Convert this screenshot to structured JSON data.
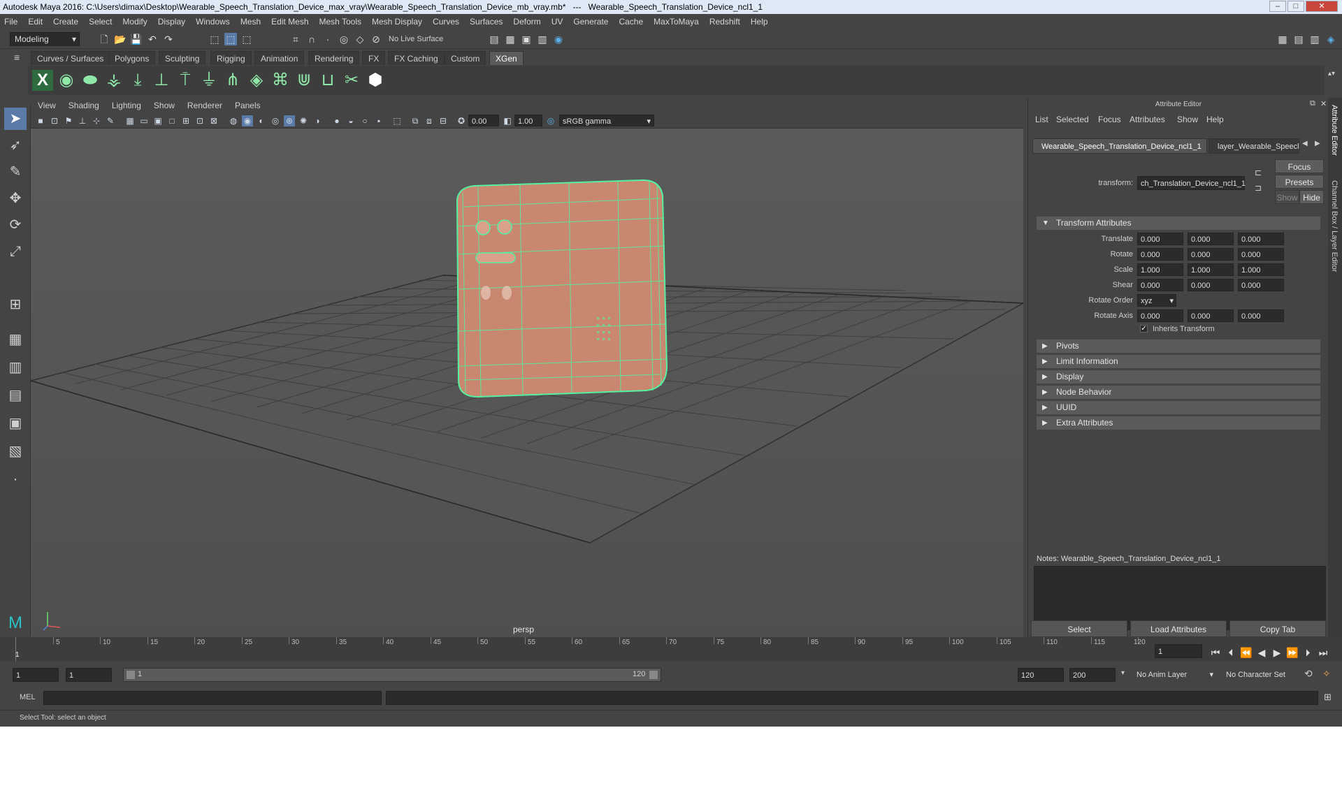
{
  "window": {
    "title": "Autodesk Maya 2016: C:\\Users\\dimax\\Desktop\\Wearable_Speech_Translation_Device_max_vray\\Wearable_Speech_Translation_Device_mb_vray.mb*",
    "separator": "---",
    "object": "Wearable_Speech_Translation_Device_ncl1_1",
    "min": "–",
    "max": "□",
    "close": "✕"
  },
  "menubar": [
    "File",
    "Edit",
    "Create",
    "Select",
    "Modify",
    "Display",
    "Windows",
    "Mesh",
    "Edit Mesh",
    "Mesh Tools",
    "Mesh Display",
    "Curves",
    "Surfaces",
    "Deform",
    "UV",
    "Generate",
    "Cache",
    "MaxToMaya",
    "Redshift",
    "Help"
  ],
  "status": {
    "mode": "Modeling",
    "live_surface": "No Live Surface"
  },
  "shelf_tabs": [
    "Curves / Surfaces",
    "Polygons",
    "Sculpting",
    "Rigging",
    "Animation",
    "Rendering",
    "FX",
    "FX Caching",
    "Custom",
    "XGen"
  ],
  "shelf_active": "XGen",
  "viewport": {
    "menus": [
      "View",
      "Shading",
      "Lighting",
      "Show",
      "Renderer",
      "Panels"
    ],
    "exposure": "0.00",
    "gamma": "1.00",
    "color_space": "sRGB gamma",
    "camera": "persp"
  },
  "attribute_editor": {
    "title": "Attribute Editor",
    "menus": [
      "List",
      "Selected",
      "Focus",
      "Attributes",
      "Show",
      "Help"
    ],
    "tab_active": "Wearable_Speech_Translation_Device_ncl1_1",
    "tab_other": "layer_Wearable_Speech_",
    "transform_label": "transform:",
    "transform_value": "ch_Translation_Device_ncl1_1",
    "focus_btn": "Focus",
    "presets_btn": "Presets",
    "show_btn": "Show",
    "hide_btn": "Hide",
    "section_transform": "Transform Attributes",
    "rows": [
      {
        "label": "Translate",
        "values": [
          "0.000",
          "0.000",
          "0.000"
        ]
      },
      {
        "label": "Rotate",
        "values": [
          "0.000",
          "0.000",
          "0.000"
        ]
      },
      {
        "label": "Scale",
        "values": [
          "1.000",
          "1.000",
          "1.000"
        ]
      },
      {
        "label": "Shear",
        "values": [
          "0.000",
          "0.000",
          "0.000"
        ]
      }
    ],
    "rotate_order_label": "Rotate Order",
    "rotate_order_value": "xyz",
    "rotate_axis_label": "Rotate Axis",
    "rotate_axis_values": [
      "0.000",
      "0.000",
      "0.000"
    ],
    "inherits_label": "Inherits Transform",
    "inherits_checked": true,
    "sections": [
      "Pivots",
      "Limit Information",
      "Display",
      "Node Behavior",
      "UUID",
      "Extra Attributes"
    ],
    "notes_label": "Notes:  Wearable_Speech_Translation_Device_ncl1_1",
    "bottom_buttons": [
      "Select",
      "Load Attributes",
      "Copy Tab"
    ],
    "side_tabs": [
      "Attribute Editor",
      "Channel Box / Layer Editor"
    ]
  },
  "timeline": {
    "ticks": [
      1,
      5,
      10,
      15,
      20,
      25,
      30,
      35,
      40,
      45,
      50,
      55,
      60,
      65,
      70,
      75,
      80,
      85,
      90,
      95,
      100,
      105,
      110,
      115,
      120
    ],
    "current_frame": "1"
  },
  "range": {
    "start": "1",
    "playback_start": "1",
    "slider_start": "1",
    "slider_end": "120",
    "playback_end": "120",
    "end": "200",
    "anim_layer": "No Anim Layer",
    "char_set": "No Character Set"
  },
  "cmd": {
    "label": "MEL"
  },
  "help": "Select Tool: select an object"
}
